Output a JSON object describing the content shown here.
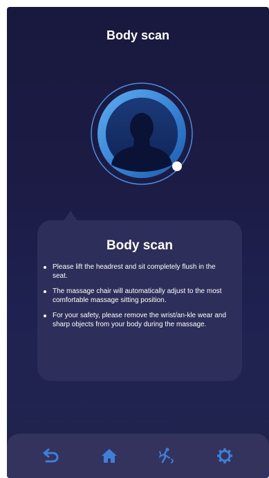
{
  "header": {
    "title": "Body scan"
  },
  "scan_indicator": {
    "icon": "person-silhouette-icon",
    "progress_handle": "progress-dot"
  },
  "info_card": {
    "title": "Body scan",
    "bullets": [
      "Please lift the headrest and sit completely flush in the seat.",
      "The massage chair will automatically adjust to the most comfortable massage sitting position.",
      "For your safety, please remove the wrist/an-kle wear and sharp objects from your body during the massage."
    ]
  },
  "bottom_nav": {
    "items": [
      {
        "icon": "back-arrow-icon"
      },
      {
        "icon": "home-icon"
      },
      {
        "icon": "massage-person-icon"
      },
      {
        "icon": "gear-icon"
      }
    ]
  },
  "colors": {
    "background": "#1b1b44",
    "card": "#2e2e5a",
    "nav_bar": "#33335e",
    "icon_blue": "#3f7fd8",
    "ring_light": "#4fa0ea",
    "ring_dark": "#1d5aa8"
  }
}
